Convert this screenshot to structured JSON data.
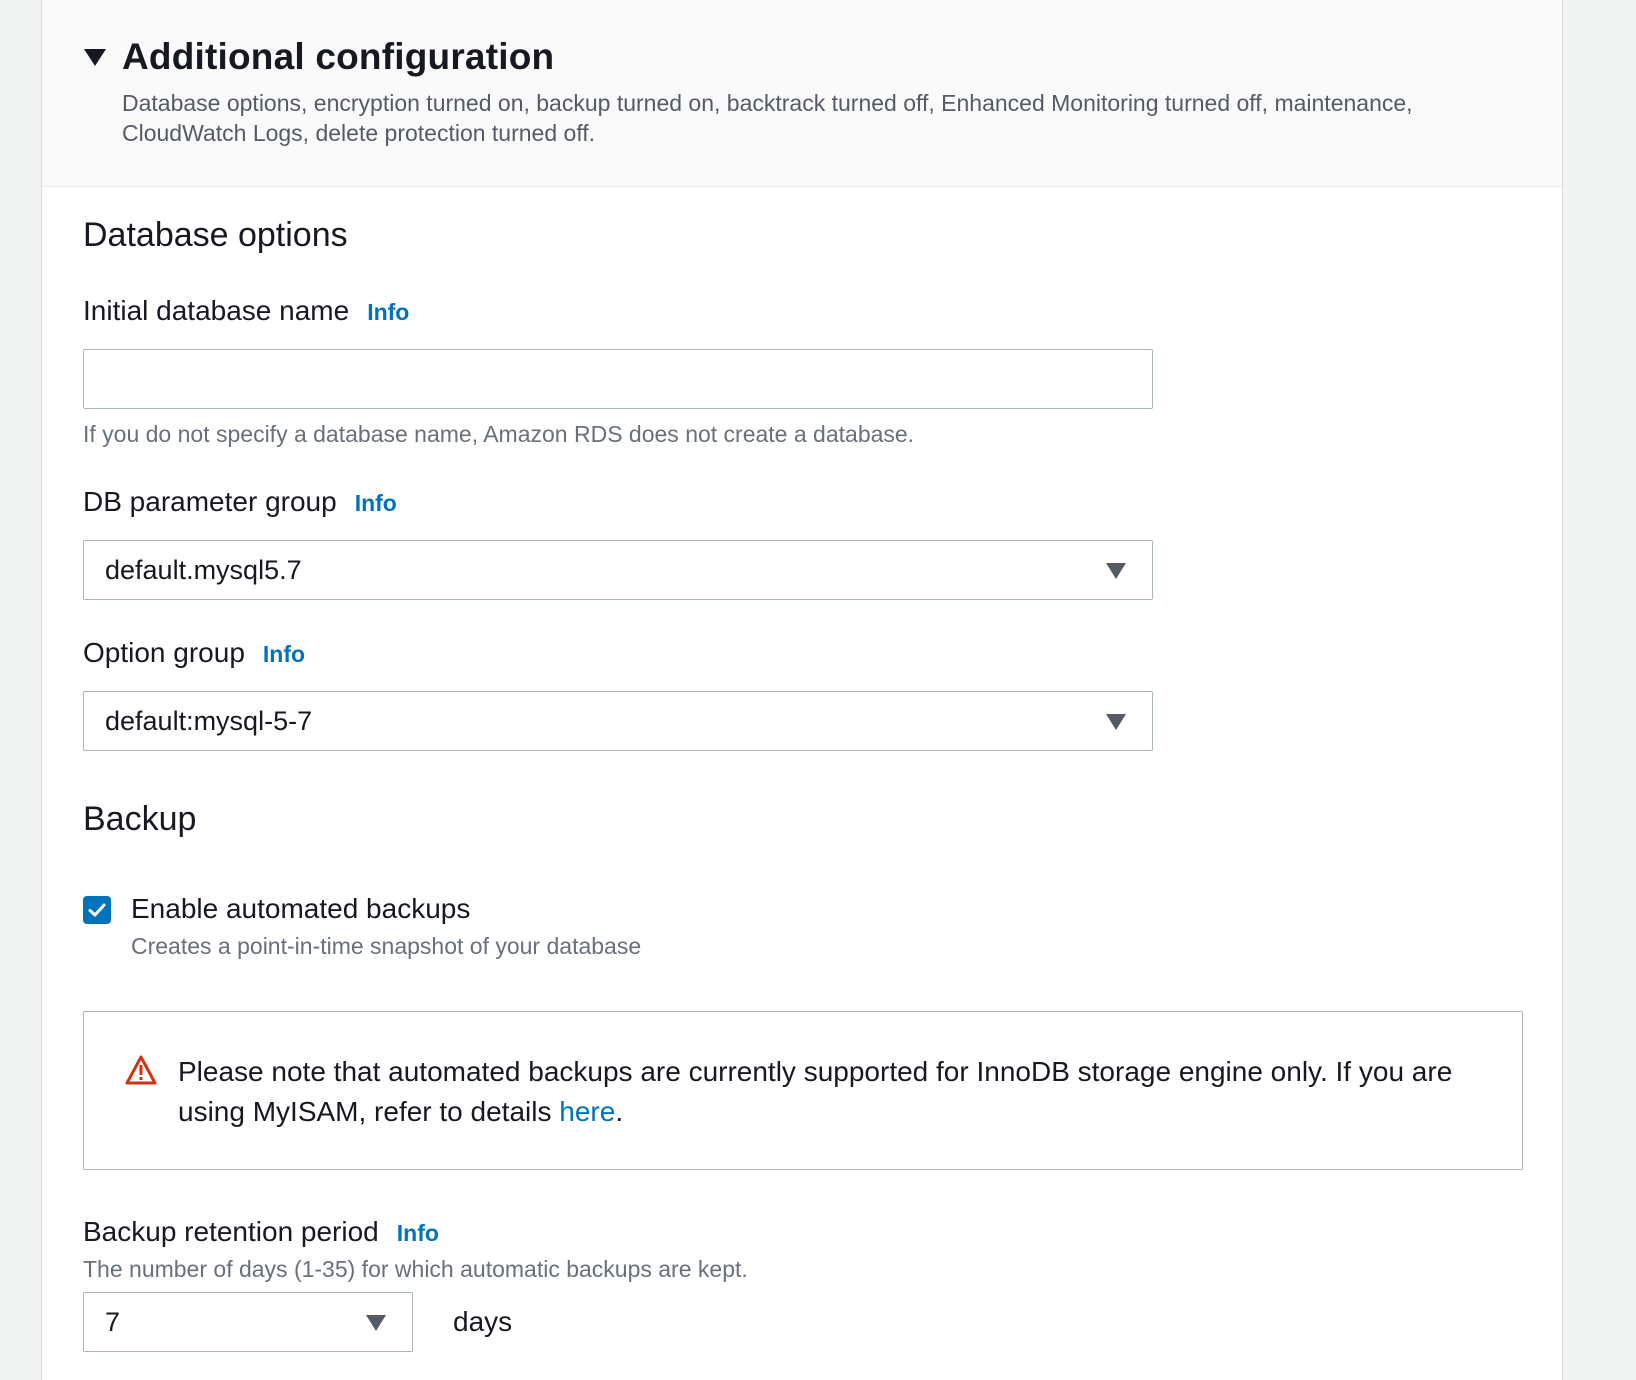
{
  "header": {
    "title": "Additional configuration",
    "description": "Database options, encryption turned on, backup turned on, backtrack turned off, Enhanced Monitoring turned off, maintenance, CloudWatch Logs, delete protection turned off."
  },
  "database_options": {
    "heading": "Database options",
    "initial_db_name": {
      "label": "Initial database name",
      "info": "Info",
      "value": "",
      "hint": "If you do not specify a database name, Amazon RDS does not create a database."
    },
    "parameter_group": {
      "label": "DB parameter group",
      "info": "Info",
      "value": "default.mysql5.7"
    },
    "option_group": {
      "label": "Option group",
      "info": "Info",
      "value": "default:mysql-5-7"
    }
  },
  "backup": {
    "heading": "Backup",
    "enable_automated": {
      "label": "Enable automated backups",
      "description": "Creates a point-in-time snapshot of your database",
      "checked": true
    },
    "alert": {
      "text_before": "Please note that automated backups are currently supported for InnoDB storage engine only. If you are using MyISAM, refer to details ",
      "link": "here",
      "text_after": "."
    },
    "retention": {
      "label": "Backup retention period",
      "info": "Info",
      "description": "The number of days (1-35) for which automatic backups are kept.",
      "value": "7",
      "unit": "days"
    }
  },
  "colors": {
    "link": "#0073bb",
    "checkbox": "#0073bb",
    "warning": "#d13212"
  }
}
